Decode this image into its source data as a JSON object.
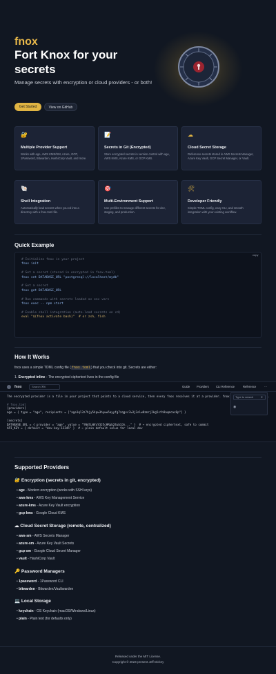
{
  "hero": {
    "brand": "fnox",
    "title": "Fort Knox for your secrets",
    "subtitle": "Manage secrets with encryption or cloud providers - or both!",
    "primary_button": "Get Started",
    "secondary_button": "View on GitHub"
  },
  "features": [
    {
      "icon": "🔐",
      "title": "Multiple Provider Support",
      "desc": "Works with age, AWS KMS/SM, Azure, GCP, 1Password, Bitwarden, HashiCorp Vault, and more."
    },
    {
      "icon": "📝",
      "title": "Secrets in Git (Encrypted)",
      "desc": "Store encrypted secrets in version control with age, AWS KMS, Azure KMS, or GCP KMS."
    },
    {
      "icon": "☁",
      "title": "Cloud Secret Storage",
      "desc": "Reference secrets stored in AWS Secrets Manager, Azure Key Vault, GCP Secret Manager, or Vault."
    },
    {
      "icon": "🐚",
      "title": "Shell Integration",
      "desc": "Automatically load secrets when you cd into a directory with a fnox.toml file."
    },
    {
      "icon": "🎯",
      "title": "Multi-Environment Support",
      "desc": "Use profiles to manage different secrets for dev, staging, and production."
    },
    {
      "icon": "🛠",
      "title": "Developer Friendly",
      "desc": "Simple TOML config, easy CLI, and smooth integration with your existing workflow."
    }
  ],
  "quick_example": {
    "heading": "Quick Example",
    "copy_label": "copy",
    "lines": [
      {
        "cls": "c",
        "text": "# Initialize fnox in your project"
      },
      {
        "cls": "k",
        "text": "fnox init"
      },
      {
        "cls": "",
        "text": ""
      },
      {
        "cls": "c",
        "text": "# Set a secret (stored in encrypted in fnox.toml)"
      },
      {
        "cls": "k",
        "text": "fnox set DATABASE_URL \"postgresql://localhost/mydb\""
      },
      {
        "cls": "",
        "text": ""
      },
      {
        "cls": "c",
        "text": "# Get a secret"
      },
      {
        "cls": "k",
        "text": "fnox get DATABASE_URL"
      },
      {
        "cls": "",
        "text": ""
      },
      {
        "cls": "c",
        "text": "# Run commands with secrets loaded as env vars"
      },
      {
        "cls": "k",
        "text": "fnox exec -- npm start"
      },
      {
        "cls": "",
        "text": ""
      },
      {
        "cls": "c",
        "text": "# Enable shell integration (auto-load secrets on cd)"
      },
      {
        "cls": "s",
        "text": "eval \"$(fnox activate bash)\"  # or zsh, fish"
      }
    ]
  },
  "how_it_works": {
    "heading": "How It Works",
    "intro_pre": "fnox uses a simple TOML config file (",
    "intro_code": "fnox.toml",
    "intro_post": ") that you check into git. Secrets are either:",
    "point1_bold": "Encrypted inline",
    "point1_rest": " - The encrypted ciphertext lives in the config file"
  },
  "docs": {
    "name": "fnox",
    "search": "Search",
    "search_key": "⌘K",
    "nav": [
      "Guide",
      "Providers",
      "CLI Reference",
      "Reference",
      "⋯"
    ],
    "dropdown_placeholder": "Type to search",
    "dropdown_clear": "✕",
    "code_lines": [
      {
        "cls": "",
        "text": "The encrypted provider is a file in your project that points to a cloud service, then every fnox resolves it at a provider. fnox uses provider secrets."
      },
      {
        "cls": "",
        "text": ""
      },
      {
        "cls": "c",
        "text": "# fnox.toml"
      },
      {
        "cls": "",
        "text": "[providers]"
      },
      {
        "cls": "",
        "text": "age = { type = \"age\", recipients = [\"age1ql3z7hjy54pw3hyww5ayyfg7zqgvc7w3j2elw8zmrj2kg5sfn9aqmcac8p\"] }"
      },
      {
        "cls": "",
        "text": ""
      },
      {
        "cls": "",
        "text": "[secrets]"
      },
      {
        "cls": "",
        "text": "DATABASE_URL = { provider = \"age\", value = \"YWdlLWVuY3J5cHRpb24ub3Jn...\" }  # ← encrypted ciphertext, safe to commit"
      },
      {
        "cls": "",
        "text": "API_KEY = { default = \"dev-key-12345\" }  # ← plain default value for local dev"
      }
    ]
  },
  "providers": {
    "heading": "Supported Providers",
    "groups": [
      {
        "title": "🔐 Encryption (secrets in git, encrypted)",
        "items": [
          {
            "name": "age",
            "desc": " - Modern encryption (works with SSH keys)"
          },
          {
            "name": "aws-kms",
            "desc": " - AWS Key Management Service"
          },
          {
            "name": "azure-kms",
            "desc": " - Azure Key Vault encryption"
          },
          {
            "name": "gcp-kms",
            "desc": " - Google Cloud KMS"
          }
        ]
      },
      {
        "title": "☁ Cloud Secret Storage (remote, centralized)",
        "items": [
          {
            "name": "aws-sm",
            "desc": " - AWS Secrets Manager"
          },
          {
            "name": "azure-sm",
            "desc": " - Azure Key Vault Secrets"
          },
          {
            "name": "gcp-sm",
            "desc": " - Google Cloud Secret Manager"
          },
          {
            "name": "vault",
            "desc": " - HashiCorp Vault"
          }
        ]
      },
      {
        "title": "🔑 Password Managers",
        "items": [
          {
            "name": "1password",
            "desc": " - 1Password CLI"
          },
          {
            "name": "bitwarden",
            "desc": " - Bitwarden/Vaultwarden"
          }
        ]
      },
      {
        "title": "💻 Local Storage",
        "items": [
          {
            "name": "keychain",
            "desc": " - OS Keychain (macOS/Windows/Linux)"
          },
          {
            "name": "plain",
            "desc": " - Plain text (for defaults only)"
          }
        ]
      }
    ]
  },
  "footer": {
    "line1": "Released under the MIT License.",
    "line2": "Copyright © 2024-present Jeff Dickey"
  },
  "colors": {
    "accent": "#e0b443",
    "background": "#111722",
    "card": "#1c2335"
  }
}
